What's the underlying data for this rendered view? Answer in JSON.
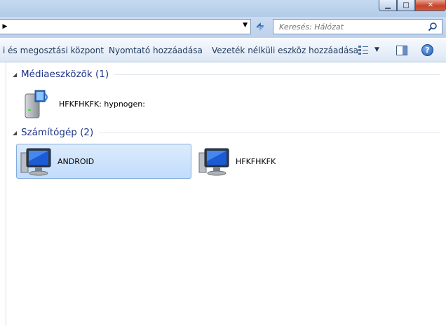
{
  "search": {
    "placeholder": "Keresés: Hálózat"
  },
  "toolbar": {
    "network_center": "i és megosztási központ",
    "add_printer": "Nyomtató hozzáadása",
    "add_wireless": "Vezeték nélküli eszköz hozzáadása"
  },
  "groups": [
    {
      "title": "Médiaeszközök (1)",
      "items": [
        {
          "label": "HFKFHKFK: hypnogen:",
          "icon": "media-device-icon"
        }
      ]
    },
    {
      "title": "Számítógép (2)",
      "items": [
        {
          "label": "ANDROID",
          "icon": "computer-icon",
          "selected": true
        },
        {
          "label": "HFKFHKFK",
          "icon": "computer-icon",
          "selected": false
        }
      ]
    }
  ],
  "colors": {
    "accent": "#1e3287",
    "selection": "#c1dcfc"
  }
}
